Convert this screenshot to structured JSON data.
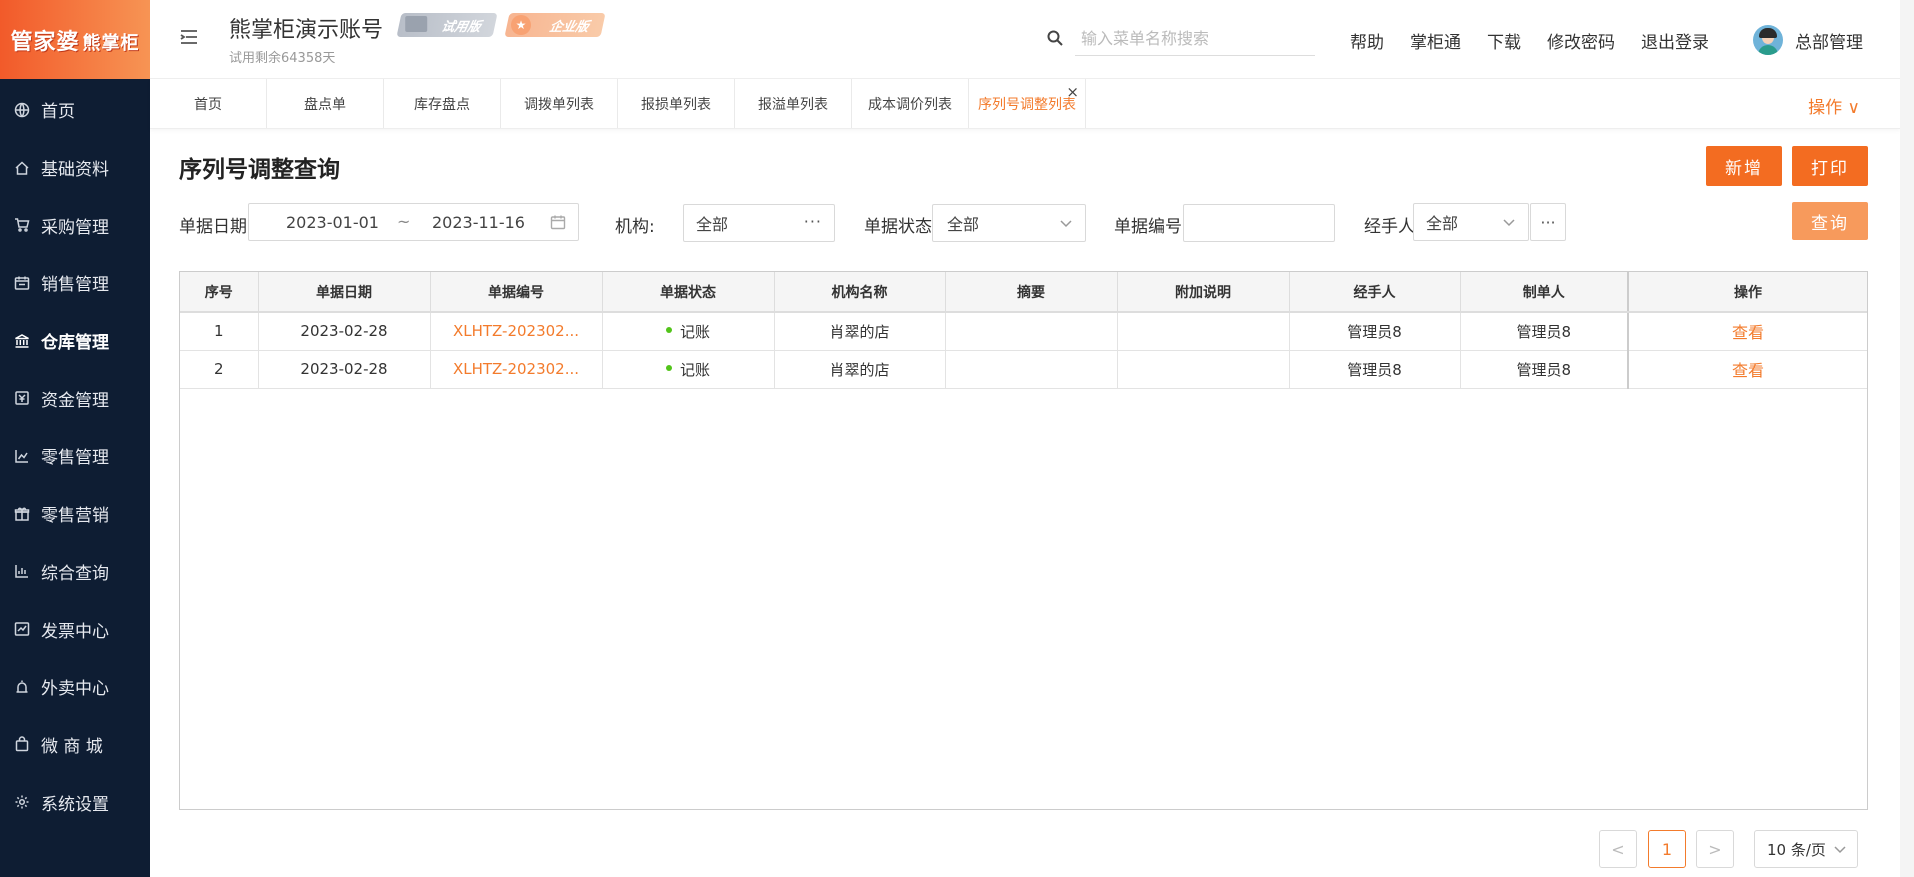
{
  "sidebar": {
    "logo_main": "管家婆",
    "logo_sub": "熊掌柜",
    "items": [
      {
        "label": "首页",
        "icon": "globe-icon"
      },
      {
        "label": "基础资料",
        "icon": "home-icon"
      },
      {
        "label": "采购管理",
        "icon": "cart-icon"
      },
      {
        "label": "销售管理",
        "icon": "calendar-icon"
      },
      {
        "label": "仓库管理",
        "icon": "bank-icon"
      },
      {
        "label": "资金管理",
        "icon": "yen-icon"
      },
      {
        "label": "零售管理",
        "icon": "chart-icon"
      },
      {
        "label": "零售营销",
        "icon": "gift-icon"
      },
      {
        "label": "综合查询",
        "icon": "bar-chart-icon"
      },
      {
        "label": "发票中心",
        "icon": "trend-icon"
      },
      {
        "label": "外卖中心",
        "icon": "alarm-icon"
      },
      {
        "label": "微 商 城",
        "icon": "bag-icon"
      },
      {
        "label": "系统设置",
        "icon": "gear-icon"
      }
    ],
    "active_index": 4
  },
  "header": {
    "account_title": "熊掌柜演示账号",
    "account_sub": "试用剩余64358天",
    "badge_trial": "试用版",
    "badge_enterprise": "企业版",
    "search_placeholder": "输入菜单名称搜索",
    "links": [
      "帮助",
      "掌柜通",
      "下载",
      "修改密码",
      "退出登录"
    ],
    "user_name": "总部管理"
  },
  "tabs": {
    "items": [
      "首页",
      "盘点单",
      "库存盘点",
      "调拨单列表",
      "报损单列表",
      "报溢单列表",
      "成本调价列表",
      "序列号调整列表"
    ],
    "active_index": 7,
    "close_glyph": "×",
    "ops_label": "操作 ∨"
  },
  "page": {
    "title": "序列号调整查询",
    "btn_new": "新增",
    "btn_print": "打印",
    "btn_query": "查询"
  },
  "filters": {
    "date_label": "单据日期",
    "date_from": "2023-01-01",
    "date_sep": "~",
    "date_to": "2023-11-16",
    "org_label": "机构:",
    "org_value": "全部",
    "status_label": "单据状态",
    "status_value": "全部",
    "number_label": "单据编号",
    "number_value": "",
    "handler_label": "经手人",
    "handler_value": "全部",
    "more_glyph": "···"
  },
  "table": {
    "columns": [
      "序号",
      "单据日期",
      "单据编号",
      "单据状态",
      "机构名称",
      "摘要",
      "附加说明",
      "经手人",
      "制单人",
      "操作"
    ],
    "rows": [
      {
        "no": "1",
        "date": "2023-02-28",
        "number": "XLHTZ-202302...",
        "status": "记账",
        "org": "肖翠的店",
        "summary": "",
        "note": "",
        "handler": "管理员8",
        "maker": "管理员8",
        "action": "查看"
      },
      {
        "no": "2",
        "date": "2023-02-28",
        "number": "XLHTZ-202302...",
        "status": "记账",
        "org": "肖翠的店",
        "summary": "",
        "note": "",
        "handler": "管理员8",
        "maker": "管理员8",
        "action": "查看"
      }
    ]
  },
  "pagination": {
    "prev": "<",
    "current": "1",
    "next": ">",
    "page_size": "10 条/页"
  },
  "colors": {
    "accent": "#f37b2c",
    "sidebar_bg": "#0e1d33",
    "status_green": "#52c41a"
  }
}
